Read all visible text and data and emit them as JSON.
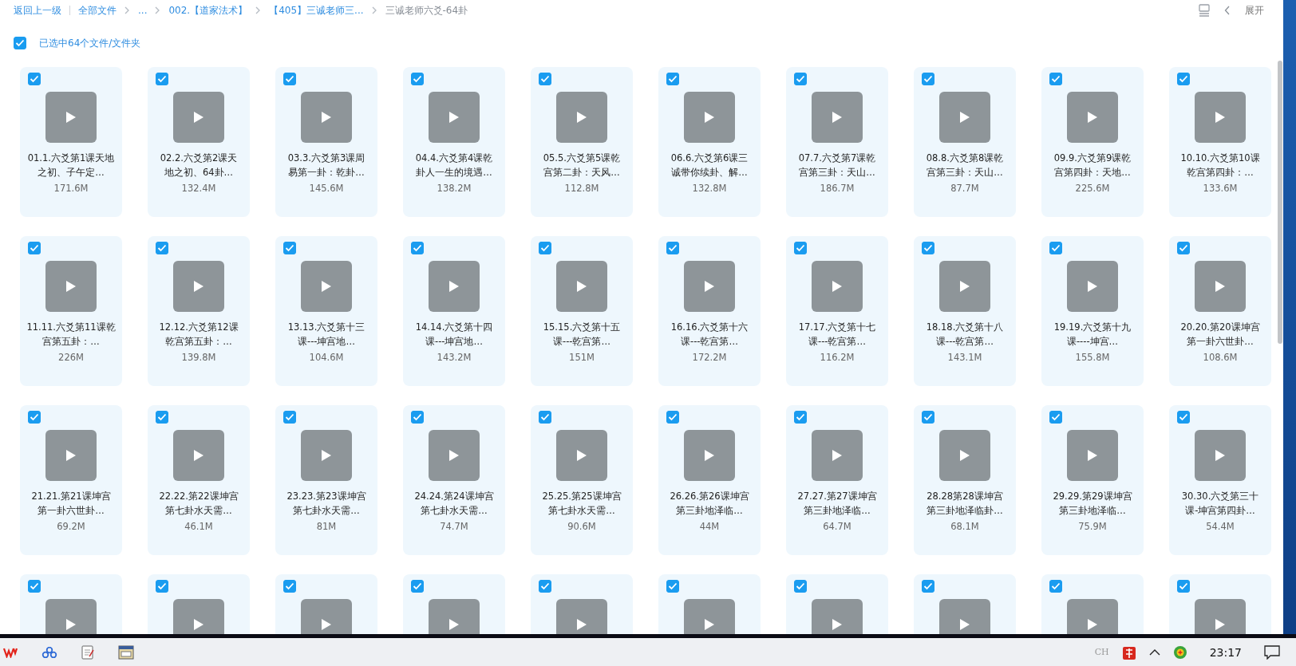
{
  "breadcrumb": {
    "back": "返回上一级",
    "items": [
      {
        "label": "全部文件",
        "current": false
      },
      {
        "label": "...",
        "current": false
      },
      {
        "label": "002.【道家法术】",
        "current": false
      },
      {
        "label": "【405】三诚老师三...",
        "current": false
      },
      {
        "label": "三诚老师六爻-64卦",
        "current": true
      }
    ]
  },
  "toolbar": {
    "expand_label": "展开"
  },
  "selection": {
    "checked": true,
    "label": "已选中64个文件/文件夹"
  },
  "files": [
    {
      "checked": true,
      "title_lines": [
        "01.1.六爻第1课天地",
        "之初、子午定…"
      ],
      "size": "171.6M"
    },
    {
      "checked": true,
      "title_lines": [
        "02.2.六爻第2课天",
        "地之初、64卦…"
      ],
      "size": "132.4M"
    },
    {
      "checked": true,
      "title_lines": [
        "03.3.六爻第3课周",
        "易第一卦：乾卦…"
      ],
      "size": "145.6M"
    },
    {
      "checked": true,
      "title_lines": [
        "04.4.六爻第4课乾",
        "卦人一生的境遇…"
      ],
      "size": "138.2M"
    },
    {
      "checked": true,
      "title_lines": [
        "05.5.六爻第5课乾",
        "宫第二卦：天风…"
      ],
      "size": "112.8M"
    },
    {
      "checked": true,
      "title_lines": [
        "06.6.六爻第6课三",
        "诚带你续卦、解…"
      ],
      "size": "132.8M"
    },
    {
      "checked": true,
      "title_lines": [
        "07.7.六爻第7课乾",
        "宫第三卦：天山…"
      ],
      "size": "186.7M"
    },
    {
      "checked": true,
      "title_lines": [
        "08.8.六爻第8课乾",
        "宫第三卦：天山…"
      ],
      "size": "87.7M"
    },
    {
      "checked": true,
      "title_lines": [
        "09.9.六爻第9课乾",
        "宫第四卦：天地…"
      ],
      "size": "225.6M"
    },
    {
      "checked": true,
      "title_lines": [
        "10.10.六爻第10课",
        "乾宫第四卦：…"
      ],
      "size": "133.6M"
    },
    {
      "checked": true,
      "title_lines": [
        "11.11.六爻第11课乾",
        "宫第五卦：…"
      ],
      "size": "226M"
    },
    {
      "checked": true,
      "title_lines": [
        "12.12.六爻第12课",
        "乾宫第五卦：…"
      ],
      "size": "139.8M"
    },
    {
      "checked": true,
      "title_lines": [
        "13.13.六爻第十三",
        "课---坤宫地…"
      ],
      "size": "104.6M"
    },
    {
      "checked": true,
      "title_lines": [
        "14.14.六爻第十四",
        "课---坤宫地…"
      ],
      "size": "143.2M"
    },
    {
      "checked": true,
      "title_lines": [
        "15.15.六爻第十五",
        "课---乾宫第…"
      ],
      "size": "151M"
    },
    {
      "checked": true,
      "title_lines": [
        "16.16.六爻第十六",
        "课---乾宫第…"
      ],
      "size": "172.2M"
    },
    {
      "checked": true,
      "title_lines": [
        "17.17.六爻第十七",
        "课---乾宫第…"
      ],
      "size": "116.2M"
    },
    {
      "checked": true,
      "title_lines": [
        "18.18.六爻第十八",
        "课---乾宫第…"
      ],
      "size": "143.1M"
    },
    {
      "checked": true,
      "title_lines": [
        "19.19.六爻第十九",
        "课----坤宫…"
      ],
      "size": "155.8M"
    },
    {
      "checked": true,
      "title_lines": [
        "20.20.第20课坤宫",
        "第一卦六世卦…"
      ],
      "size": "108.6M"
    },
    {
      "checked": true,
      "title_lines": [
        "21.21.第21课坤宫",
        "第一卦六世卦…"
      ],
      "size": "69.2M"
    },
    {
      "checked": true,
      "title_lines": [
        "22.22.第22课坤宫",
        "第七卦水天需…"
      ],
      "size": "46.1M"
    },
    {
      "checked": true,
      "title_lines": [
        "23.23.第23课坤宫",
        "第七卦水天需…"
      ],
      "size": "81M"
    },
    {
      "checked": true,
      "title_lines": [
        "24.24.第24课坤宫",
        "第七卦水天需…"
      ],
      "size": "74.7M"
    },
    {
      "checked": true,
      "title_lines": [
        "25.25.第25课坤宫",
        "第七卦水天需…"
      ],
      "size": "90.6M"
    },
    {
      "checked": true,
      "title_lines": [
        "26.26.第26课坤宫",
        "第三卦地泽临…"
      ],
      "size": "44M"
    },
    {
      "checked": true,
      "title_lines": [
        "27.27.第27课坤宫",
        "第三卦地泽临…"
      ],
      "size": "64.7M"
    },
    {
      "checked": true,
      "title_lines": [
        "28.28第28课坤宫",
        "第三卦地泽临卦…"
      ],
      "size": "68.1M"
    },
    {
      "checked": true,
      "title_lines": [
        "29.29.第29课坤宫",
        "第三卦地泽临…"
      ],
      "size": "75.9M"
    },
    {
      "checked": true,
      "title_lines": [
        "30.30.六爻第三十",
        "课-坤宫第四卦…"
      ],
      "size": "54.4M"
    },
    {
      "checked": true
    },
    {
      "checked": true
    },
    {
      "checked": true
    },
    {
      "checked": true
    },
    {
      "checked": true
    },
    {
      "checked": true
    },
    {
      "checked": true
    },
    {
      "checked": true
    },
    {
      "checked": true
    },
    {
      "checked": true
    }
  ],
  "taskbar": {
    "language": "CH",
    "time": "23:17"
  }
}
